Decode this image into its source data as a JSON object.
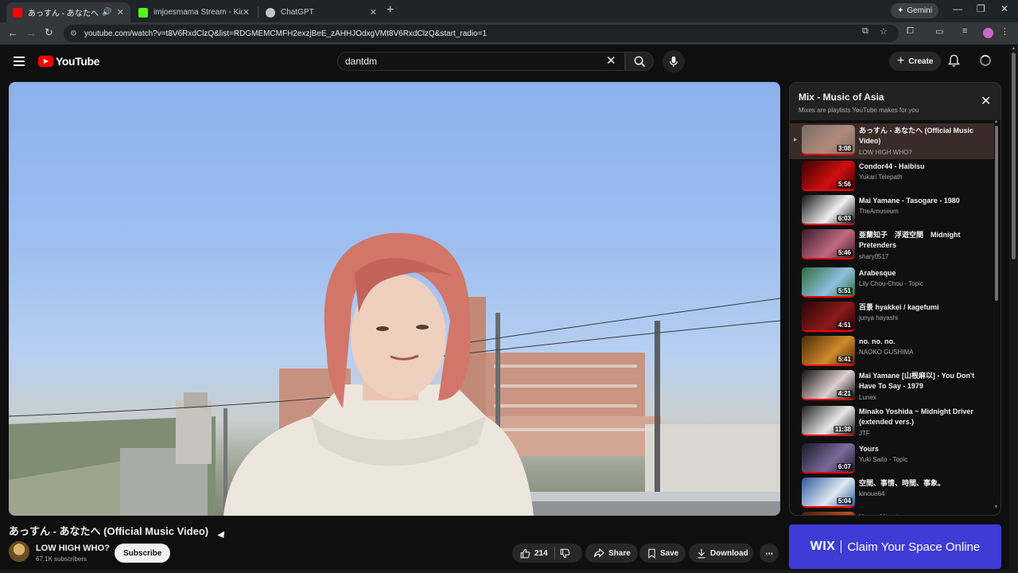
{
  "browser": {
    "tabs": [
      {
        "title": "あっすん - あなたへ (Official M",
        "favicon": "youtube-favicon",
        "color": "#ff0000",
        "active": true,
        "audio": true
      },
      {
        "title": "imjoesmama Stream - Kick Das",
        "favicon": "kick-favicon",
        "color": "#53fc18",
        "active": false
      },
      {
        "title": "ChatGPT",
        "favicon": "chatgpt-favicon",
        "color": "#bfc3c7",
        "active": false
      }
    ],
    "gemini_label": "Gemini",
    "url": "youtube.com/watch?v=t8V6RxdClzQ&list=RDGMEMCMFH2exzjBeE_zAHHJOdxgVMt8V6RxdClzQ&start_radio=1"
  },
  "youtube": {
    "logo_text": "YouTube",
    "search_value": "dantdm",
    "create_label": "Create",
    "brand_color": "#ff0000"
  },
  "video": {
    "title": "あっすん - あなたへ (Official Music Video)",
    "channel": "LOW HIGH WHO?",
    "subscribers": "67.1K subscribers",
    "subscribe_label": "Subscribe",
    "likes": "214",
    "share_label": "Share",
    "save_label": "Save",
    "download_label": "Download"
  },
  "playlist": {
    "title": "Mix - Music of Asia",
    "subtitle": "Mixes are playlists YouTube makes for you",
    "items": [
      {
        "title": "あっすん - あなたへ (Official Music Video)",
        "channel": "LOW HIGH WHO?",
        "duration": "3:08",
        "current": true,
        "thumb": [
          "#7a6c68",
          "#b08a7c"
        ]
      },
      {
        "title": "Condor44 - Haibisu",
        "channel": "Yukari Telepath",
        "duration": "5:56",
        "thumb": [
          "#3a0000",
          "#d10f0f"
        ]
      },
      {
        "title": "Mai Yamane - Tasogare - 1980",
        "channel": "TheAmuseum",
        "duration": "6:03",
        "thumb": [
          "#111111",
          "#f0f0f0"
        ]
      },
      {
        "title": "亜蘭知子　浮遊空間　Midnight Pretenders",
        "channel": "shary0517",
        "duration": "5:46",
        "thumb": [
          "#3a1a2a",
          "#c06a80"
        ]
      },
      {
        "title": "Arabesque",
        "channel": "Lily Chou-Chou - Topic",
        "duration": "5:51",
        "thumb": [
          "#2f6b3a",
          "#8fc0e0"
        ]
      },
      {
        "title": "百景 hyakkei / kagefumi",
        "channel": "junya hayashi",
        "duration": "4:51",
        "thumb": [
          "#2a0606",
          "#8a1a1a"
        ]
      },
      {
        "title": "no. no. no.",
        "channel": "NAOKO GUSHIMA",
        "duration": "5:41",
        "thumb": [
          "#4a2a0a",
          "#d08a2a"
        ]
      },
      {
        "title": "Mai Yamane [山根麻以] - You Don't Have To Say - 1979",
        "channel": "Lunex",
        "duration": "4:21",
        "thumb": [
          "#101010",
          "#e0d0d0"
        ]
      },
      {
        "title": "Minako Yoshida ~ Midnight Driver (extended vers.)",
        "channel": "JTF",
        "duration": "11:38",
        "thumb": [
          "#202020",
          "#e8e8e8"
        ]
      },
      {
        "title": "Yours",
        "channel": "Yuki Saito - Topic",
        "duration": "6:07",
        "thumb": [
          "#1a1a2a",
          "#7a6a9a"
        ]
      },
      {
        "title": "空間、事情、時間、事象。",
        "channel": "kinoue64",
        "duration": "5:04",
        "thumb": [
          "#2a5aa0",
          "#e0e8f0"
        ]
      },
      {
        "title": "Yume Utsutsu",
        "channel": "",
        "duration": "",
        "thumb": [
          "#4a1a10",
          "#c04a20"
        ]
      }
    ]
  },
  "ad": {
    "brand": "WIX",
    "slogan": "Claim Your Space Online",
    "color": "#3e3bd6"
  }
}
